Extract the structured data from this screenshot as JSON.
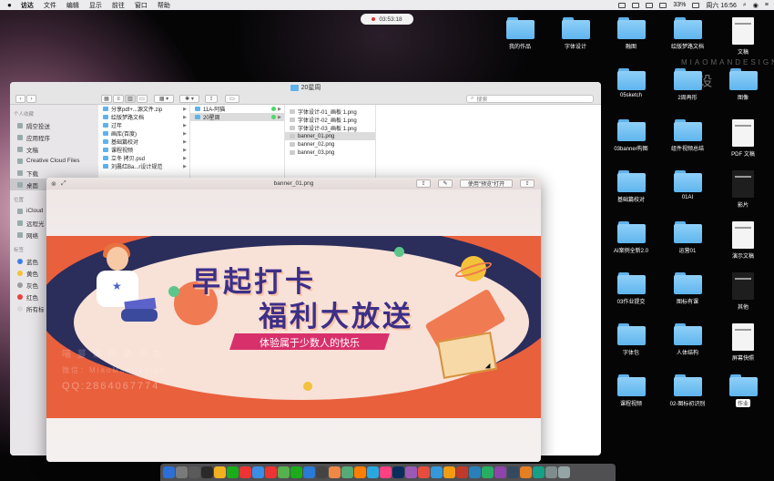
{
  "menubar": {
    "app": "访达",
    "items": [
      "文件",
      "编辑",
      "显示",
      "前往",
      "窗口",
      "帮助"
    ],
    "battery": "33%",
    "clock": "周六 16:56"
  },
  "recorder": {
    "time": "03:53:18"
  },
  "desktop": {
    "watermark_en": "MIAOMANDESIGN",
    "watermark_cn": "曼 设",
    "icons": [
      {
        "label": "我的作品",
        "kind": "folder"
      },
      {
        "label": "字体设计",
        "kind": "folder"
      },
      {
        "label": "融图",
        "kind": "folder"
      },
      {
        "label": "绘版梦路文档",
        "kind": "folder"
      },
      {
        "label": "文稿",
        "kind": "doc"
      },
      {
        "label": "05sketch",
        "kind": "folder"
      },
      {
        "label": "2周再形",
        "kind": "folder"
      },
      {
        "label": "图像",
        "kind": "folder"
      },
      {
        "label": "03banner构图",
        "kind": "folder"
      },
      {
        "label": "组件视频总结",
        "kind": "folder"
      },
      {
        "label": "PDF 文稿",
        "kind": "doc"
      },
      {
        "label": "基础篇校对",
        "kind": "folder"
      },
      {
        "label": "01AI",
        "kind": "folder"
      },
      {
        "label": "影片",
        "kind": "doc"
      },
      {
        "label": "AI案例全新2.0",
        "kind": "folder"
      },
      {
        "label": "运营01",
        "kind": "folder"
      },
      {
        "label": "演示文稿",
        "kind": "doc"
      },
      {
        "label": "03作业提交",
        "kind": "folder"
      },
      {
        "label": "图标有课",
        "kind": "folder"
      },
      {
        "label": "其他",
        "kind": "doc"
      },
      {
        "label": "字体包",
        "kind": "folder"
      },
      {
        "label": "人体结构",
        "kind": "folder"
      },
      {
        "label": "屏幕快照",
        "kind": "doc"
      },
      {
        "label": "课程视频",
        "kind": "folder"
      },
      {
        "label": "02-图标初识别",
        "kind": "folder"
      },
      {
        "label": "作业",
        "kind": "folder"
      }
    ]
  },
  "finder": {
    "title": "20星周",
    "search_placeholder": "搜索",
    "sidebar": {
      "sec_favorites": "个人收藏",
      "favorites": [
        "隔空投送",
        "应用程序",
        "文稿",
        "Creative Cloud Files",
        "下载",
        "桌面"
      ],
      "sec_devices": "位置",
      "devices": [
        "iCloud",
        "远程光",
        "网络"
      ],
      "sec_tags": "标签",
      "tags": [
        {
          "label": "蓝色",
          "color": "#3f7de8"
        },
        {
          "label": "黄色",
          "color": "#f2c338"
        },
        {
          "label": "灰色",
          "color": "#9b9b9b"
        },
        {
          "label": "红色",
          "color": "#e8433b"
        },
        {
          "label": "所有标",
          "color": "#d8d8d8"
        }
      ]
    },
    "col1": [
      "分享pdf+...源文件.zip",
      "绘版梦路文档",
      "过年",
      "画库(百度)",
      "基础篇校对",
      "课程视频",
      "立冬 拷贝.psd",
      "刘晨红Ba...r设计规范"
    ],
    "col2": [
      "11A-阿猫",
      "20星周"
    ],
    "col3": [
      "字体设计-01_画板 1.png",
      "字体设计-02_画板 1.png",
      "字体设计-03_画板 1.png",
      "banner_01.png",
      "banner_02.png",
      "banner_03.png"
    ]
  },
  "preview": {
    "title": "banner_01.png",
    "open_button": "使用\"预览\"打开",
    "banner": {
      "line1": "早起打卡",
      "line2": "福利大放送",
      "ribbon": "体验属于少数人的快乐"
    },
    "wm1": "喵 蔓 课 程 请 添 加",
    "wm2": "微信：MiaoManDesign",
    "wm3": "QQ:2864067774"
  },
  "dock": {
    "colors": [
      "#2c6fd6",
      "#7a7a7a",
      "#5a5a5a",
      "#2a2a2a",
      "#f0b020",
      "#1aad19",
      "#e33",
      "#3a8ee6",
      "#e33",
      "#56b04e",
      "#1aad19",
      "#2a7ad8",
      "#444",
      "#e84",
      "#5a7",
      "#ff7e00",
      "#29a8e0",
      "#ff4081",
      "#0a2d5e",
      "#9b59b6",
      "#e74c3c",
      "#3498db",
      "#f39c12",
      "#c0392b",
      "#2980b9",
      "#27ae60",
      "#8e44ad",
      "#34495e",
      "#e67e22",
      "#16a085",
      "#7f8c8d",
      "#95a5a6"
    ]
  }
}
